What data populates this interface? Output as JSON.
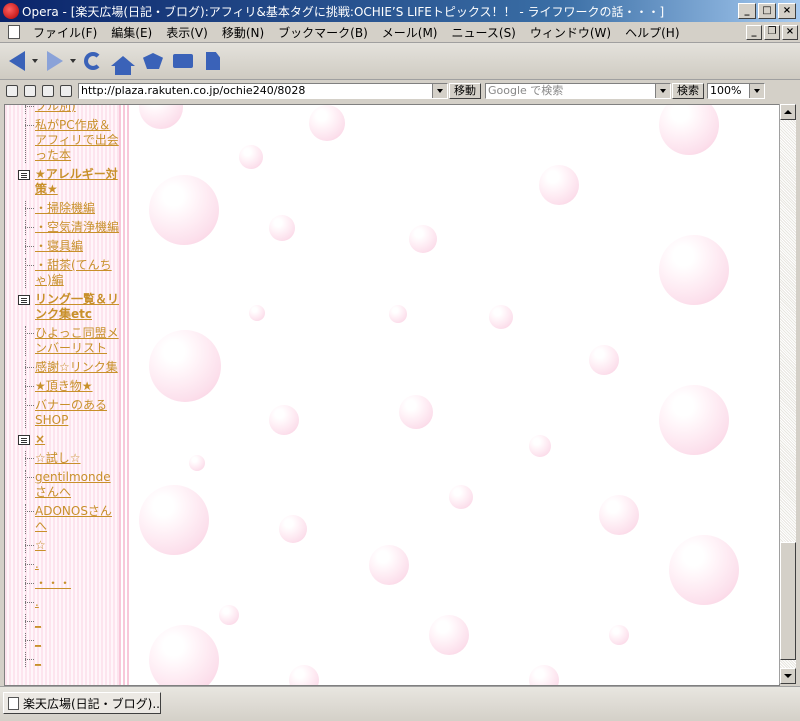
{
  "window": {
    "app_name": "Opera",
    "title": "Opera - [楽天広場(日記・ブログ):アフィリ&基本タグに挑戦:OCHIE’S LIFEトピックス！！ - ライフワークの話・・・]",
    "minimize_glyph": "_",
    "maximize_glyph": "□",
    "close_glyph": "×",
    "restore_glyph": "❐"
  },
  "menu": {
    "items": [
      "ファイル(F)",
      "編集(E)",
      "表示(V)",
      "移動(N)",
      "ブックマーク(B)",
      "メール(M)",
      "ニュース(S)",
      "ウィンドウ(W)",
      "ヘルプ(H)"
    ]
  },
  "toolbar": {
    "icons": [
      "back-arrow-icon",
      "forward-arrow-icon",
      "reload-icon",
      "home-icon",
      "hotlist-icon",
      "print-icon",
      "page-icon"
    ]
  },
  "address": {
    "url": "http://plaza.rakuten.co.jp/ochie240/8028",
    "go_label": "移動",
    "search_placeholder": "Google で検索",
    "search_label": "検索",
    "zoom": "100%"
  },
  "sidebar": {
    "items": [
      {
        "type": "link",
        "text": "ブル別)"
      },
      {
        "type": "link",
        "text": "私がPC作成＆アフィリで出会った本"
      },
      {
        "type": "category",
        "text": "★アレルギー対策★"
      },
      {
        "type": "link",
        "text": "・掃除機編"
      },
      {
        "type": "link",
        "text": "・空気清浄機編"
      },
      {
        "type": "link",
        "text": "・寝具編"
      },
      {
        "type": "link",
        "text": "・甜茶(てんちゃ)編"
      },
      {
        "type": "category",
        "text": "リング一覧＆リンク集etc"
      },
      {
        "type": "link",
        "text": "ひよっこ同盟メンバーリスト"
      },
      {
        "type": "link",
        "text": "感謝☆リンク集"
      },
      {
        "type": "link",
        "text": "★頂き物★"
      },
      {
        "type": "link",
        "text": "バナーのあるSHOP"
      },
      {
        "type": "category",
        "text": "×"
      },
      {
        "type": "link",
        "text": "☆試し☆"
      },
      {
        "type": "link",
        "text": "gentilmondeさんへ"
      },
      {
        "type": "link",
        "text": "ADONOSさんへ"
      },
      {
        "type": "link",
        "text": "☆"
      },
      {
        "type": "link",
        "text": "."
      },
      {
        "type": "link",
        "text": "・・・"
      },
      {
        "type": "link",
        "text": "."
      },
      {
        "type": "link",
        "text": "_"
      },
      {
        "type": "link",
        "text": "_"
      },
      {
        "type": "link",
        "text": "_"
      }
    ]
  },
  "pagebar": {
    "tab_title": "楽天広場(日記・ブログ)..."
  },
  "colors": {
    "link": "#c8902a",
    "sidebar_bg": "#fde4ee",
    "title_bar": "#0a246a"
  }
}
